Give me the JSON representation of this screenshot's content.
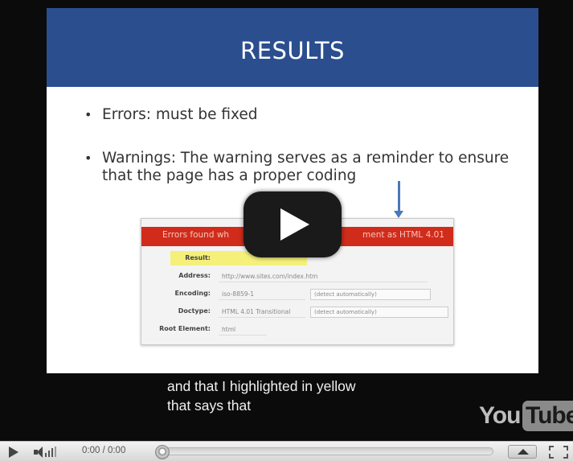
{
  "slide": {
    "title": "RESULTS",
    "bullets": [
      "Errors: must be fixed",
      "Warnings: The warning serves as a reminder to ensure that the page has a proper coding"
    ],
    "header_color": "#2b4e8f"
  },
  "validator": {
    "banner_text": "Errors found wh",
    "banner_tail": "ment as HTML 4.01",
    "banner_color": "#d12c1b",
    "highlight_color": "#f4f07a",
    "rows": [
      {
        "label": "Result:",
        "value": "",
        "select": ""
      },
      {
        "label": "Address:",
        "value": "http://www.sites.com/index.htm",
        "select": ""
      },
      {
        "label": "Encoding:",
        "value": "iso-8859-1",
        "select": "(detect automatically)"
      },
      {
        "label": "Doctype:",
        "value": "HTML 4.01 Transitional",
        "select": "(detect automatically)"
      },
      {
        "label": "Root Element:",
        "value": "html",
        "select": ""
      }
    ]
  },
  "caption": {
    "line1": "and that I highlighted in yellow",
    "line2": "that says that"
  },
  "logo": {
    "part1": "You",
    "part2": "Tube"
  },
  "controls": {
    "time": "0:00 / 0:00"
  },
  "icons": {
    "play": "play-icon",
    "volume": "volume-icon",
    "big_play": "big-play-icon",
    "screen": "screen-size-icon",
    "fullscreen": "fullscreen-icon"
  }
}
